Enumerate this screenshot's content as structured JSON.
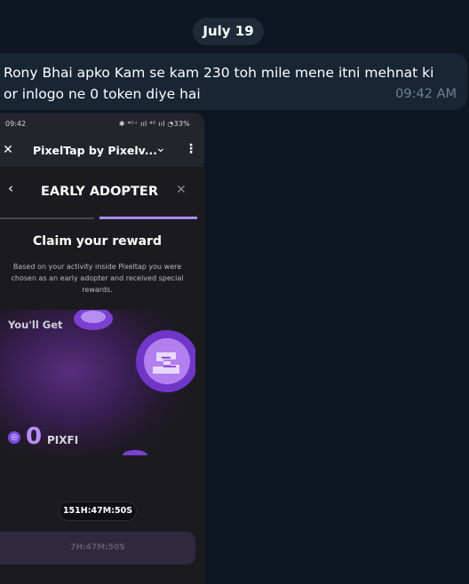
{
  "chat": {
    "date": "July 19",
    "message": {
      "text": "Rony Bhai apko Kam se kam 230 toh mile mene itni mehnat ki or inlogo ne 0 token diye hai",
      "time": "09:42 AM"
    }
  },
  "screenshot": {
    "status_bar": {
      "time": "09:42",
      "icons": "✱ ⁴ᴳ⁺ ııl ⁴ᴳ ııl ◔33%",
      "battery": "33%"
    },
    "app_bar": {
      "title": "PixelTap by Pixelv...",
      "close_icon": "close-icon",
      "chevron_icon": "chevron-down-icon",
      "menu_icon": "kebab-menu-icon"
    },
    "modal": {
      "back_icon": "chevron-left-icon",
      "title": "EARLY ADOPTER",
      "close_icon": "close-icon",
      "progress": {
        "steps": 2,
        "active_step": 2
      },
      "claim_title": "Claim your reward",
      "claim_description": "Based on your activity inside Pixeltap you were chosen as an early adopter and received special rewards.",
      "reward": {
        "label": "You'll Get",
        "amount": "0",
        "symbol": "PIXFI",
        "token_icon": "pixfi-token-icon"
      },
      "timer": "151H:47M:50S",
      "claim_button_label": "7H:47M:50S"
    }
  },
  "colors": {
    "background": "#0e1621",
    "bubble": "#182533",
    "date_pill": "#1d2a38",
    "accent_purple": "#a98bf0",
    "token_amount": "#b98cff"
  }
}
